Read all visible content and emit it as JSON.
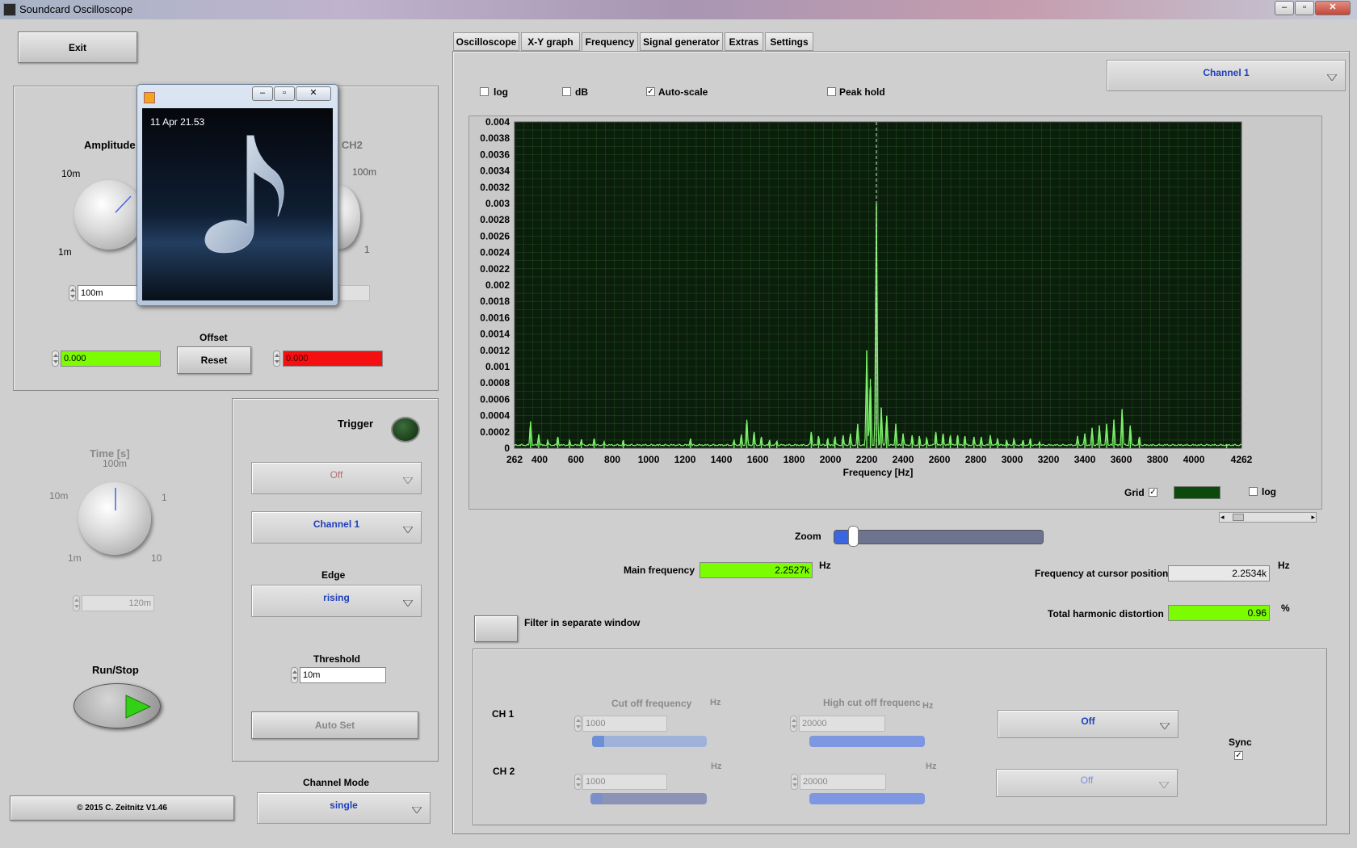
{
  "window": {
    "title": "Soundcard Oscilloscope"
  },
  "exit_label": "Exit",
  "ch1": {
    "amplitude_label": "Amplitude",
    "knob_ticks": [
      "10m",
      "1m"
    ],
    "amplitude_value": "100m"
  },
  "ch2": {
    "amplitude_label_partial": "e CH2",
    "knob_ticks": [
      "100m",
      "1"
    ]
  },
  "offset": {
    "label": "Offset",
    "reset_label": "Reset",
    "ch1_value": "0.000",
    "ch2_value": "0.000"
  },
  "time": {
    "label": "Time [s]",
    "ticks": [
      "100m",
      "10m",
      "1",
      "1m",
      "10"
    ],
    "value": "120m"
  },
  "run_stop_label": "Run/Stop",
  "trigger": {
    "label": "Trigger",
    "mode": "Off",
    "channel": "Channel 1",
    "edge_label": "Edge",
    "edge": "rising",
    "threshold_label": "Threshold",
    "threshold": "10m",
    "autoset_label": "Auto Set"
  },
  "copyright": "© 2015  C. Zeitnitz V1.46",
  "channel_mode": {
    "label": "Channel Mode",
    "value": "single"
  },
  "tabs": [
    "Oscilloscope",
    "X-Y graph",
    "Frequency",
    "Signal generator",
    "Extras",
    "Settings"
  ],
  "active_tab": "Frequency",
  "freq": {
    "channel_select": "Channel 1",
    "opt_log": "log",
    "opt_db": "dB",
    "opt_autoscale": "Auto-scale",
    "opt_peakhold": "Peak hold",
    "grid_label": "Grid",
    "log_label": "log",
    "zoom_label": "Zoom",
    "main_frequency_label": "Main frequency",
    "main_frequency": "2.2527k",
    "main_unit": "Hz",
    "cursor_frequency_label": "Frequency at cursor position",
    "cursor_frequency": "2.2534k",
    "cursor_unit": "Hz",
    "thd_label": "Total harmonic distortion",
    "thd": "0.96",
    "thd_unit": "%",
    "filter_window_label": "Filter in separate window"
  },
  "filter": {
    "cutoff_label": "Cut off frequency",
    "highcut_label": "High cut off frequenc",
    "unit": "Hz",
    "ch1_label": "CH 1",
    "ch2_label": "CH 2",
    "ch1_cutoff": "1000",
    "ch1_highcut": "20000",
    "ch2_cutoff": "1000",
    "ch2_highcut": "20000",
    "ch1_mode": "Off",
    "ch2_mode": "Off",
    "sync_label": "Sync"
  },
  "popup": {
    "date": "11 Apr 21.53"
  },
  "chart_data": {
    "type": "line",
    "xlabel": "Frequency [Hz]",
    "xlim": [
      262,
      4262
    ],
    "ylim": [
      0,
      0.004
    ],
    "x_ticks": [
      "262",
      "400",
      "600",
      "800",
      "1000",
      "1200",
      "1400",
      "1600",
      "1800",
      "2000",
      "2200",
      "2400",
      "2600",
      "2800",
      "3000",
      "3200",
      "3400",
      "3600",
      "3800",
      "4000",
      "4262"
    ],
    "y_ticks": [
      "0",
      "0.0002",
      "0.0004",
      "0.0006",
      "0.0008",
      "0.001",
      "0.0012",
      "0.0014",
      "0.0016",
      "0.0018",
      "0.002",
      "0.0022",
      "0.0024",
      "0.0026",
      "0.0028",
      "0.003",
      "0.0032",
      "0.0034",
      "0.0036",
      "0.0038",
      "0.004"
    ],
    "cursor_x": 2253,
    "grid": true,
    "peaks": [
      [
        350,
        0.00033
      ],
      [
        395,
        0.00017
      ],
      [
        445,
        0.0001
      ],
      [
        500,
        0.00014
      ],
      [
        565,
        0.0001
      ],
      [
        630,
        0.00011
      ],
      [
        700,
        0.00012
      ],
      [
        755,
        8e-05
      ],
      [
        860,
        0.0001
      ],
      [
        1230,
        0.00012
      ],
      [
        1470,
        0.0001
      ],
      [
        1510,
        0.00017
      ],
      [
        1540,
        0.00035
      ],
      [
        1580,
        0.0002
      ],
      [
        1620,
        0.00014
      ],
      [
        1665,
        0.0001
      ],
      [
        1705,
        9e-05
      ],
      [
        1895,
        0.0002
      ],
      [
        1935,
        0.00015
      ],
      [
        1985,
        0.00012
      ],
      [
        2025,
        0.00014
      ],
      [
        2070,
        0.00016
      ],
      [
        2110,
        0.00018
      ],
      [
        2150,
        0.0003
      ],
      [
        2200,
        0.0012
      ],
      [
        2220,
        0.00085
      ],
      [
        2253,
        0.003
      ],
      [
        2280,
        0.0005
      ],
      [
        2310,
        0.0004
      ],
      [
        2360,
        0.0003
      ],
      [
        2400,
        0.00018
      ],
      [
        2450,
        0.00016
      ],
      [
        2490,
        0.00015
      ],
      [
        2530,
        0.00013
      ],
      [
        2580,
        0.0002
      ],
      [
        2620,
        0.00018
      ],
      [
        2660,
        0.00016
      ],
      [
        2700,
        0.00016
      ],
      [
        2740,
        0.00015
      ],
      [
        2790,
        0.00014
      ],
      [
        2830,
        0.00014
      ],
      [
        2880,
        0.00016
      ],
      [
        2920,
        0.00012
      ],
      [
        2970,
        0.0001
      ],
      [
        3010,
        0.00012
      ],
      [
        3060,
        0.0001
      ],
      [
        3100,
        0.00012
      ],
      [
        3150,
        8e-05
      ],
      [
        3360,
        0.00015
      ],
      [
        3400,
        0.00018
      ],
      [
        3440,
        0.00025
      ],
      [
        3480,
        0.00028
      ],
      [
        3520,
        0.0003
      ],
      [
        3560,
        0.00035
      ],
      [
        3605,
        0.00048
      ],
      [
        3650,
        0.00028
      ],
      [
        3700,
        0.00014
      ],
      [
        4180,
        5e-05
      ]
    ]
  }
}
